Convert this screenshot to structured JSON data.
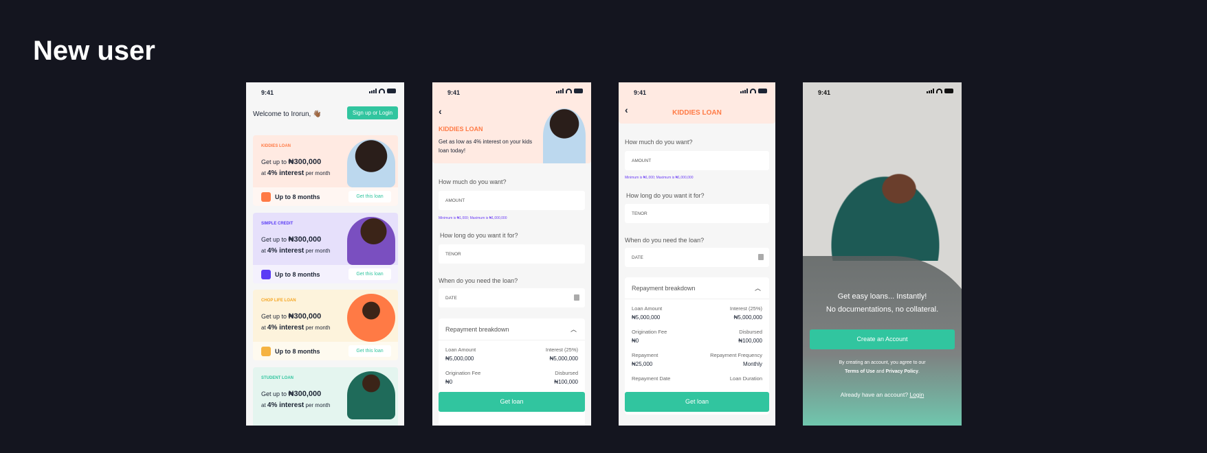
{
  "page_title": "New user",
  "status_time": "9:41",
  "colors": {
    "accent": "#31c59f",
    "kiddies": "#ff7a45",
    "simple": "#5b3df5",
    "chop": "#f5a623",
    "student": "#31c59f",
    "background": "#14151f"
  },
  "home": {
    "welcome": "Welcome to Irorun, 👋🏾",
    "signup_button": "Sign up or Login",
    "cards": [
      {
        "tag": "KIDDIES LOAN",
        "line1_prefix": "Get up to ",
        "amount": "₦300,000",
        "line2_prefix": "at ",
        "rate": "4% interest",
        "line2_suffix": " per month",
        "duration": "Up to 8 months",
        "button": "Get this loan"
      },
      {
        "tag": "SIMPLE CREDIT",
        "line1_prefix": "Get up to ",
        "amount": "₦300,000",
        "line2_prefix": "at ",
        "rate": "4% interest",
        "line2_suffix": " per month",
        "duration": "Up to 8 months",
        "button": "Get this loan"
      },
      {
        "tag": "CHOP LIFE LOAN",
        "line1_prefix": "Get up to ",
        "amount": "₦300,000",
        "line2_prefix": "at ",
        "rate": "4% interest",
        "line2_suffix": " per month",
        "duration": "Up to 8 months",
        "button": "Get this loan"
      },
      {
        "tag": "STUDENT LOAN",
        "line1_prefix": "Get up to ",
        "amount": "₦300,000",
        "line2_prefix": "at ",
        "rate": "4% interest",
        "line2_suffix": " per month"
      }
    ]
  },
  "loan_form": {
    "title": "KIDDIES LOAN",
    "subtitle": "Get as low as 4% interest on your kids loan today!",
    "q_amount": "How much do you want?",
    "amount_placeholder": "AMOUNT",
    "amount_help": "Minimum is ₦1,000; Maximum is ₦1,000,000",
    "q_tenor": "How long do you want it for?",
    "tenor_placeholder": "TENOR",
    "q_date": "When do you need the loan?",
    "date_placeholder": "DATE",
    "breakdown_title": "Repayment breakdown",
    "rows": [
      {
        "l": "Loan Amount",
        "lv": "₦5,000,000",
        "r": "Interest (25%)",
        "rv": "₦5,000,000"
      },
      {
        "l": "Origination Fee",
        "lv": "₦0",
        "r": "Disbursed",
        "rv": "₦100,000"
      },
      {
        "l": "Repayment",
        "lv": "₦25,000",
        "r": "Repayment Frequency",
        "rv": "Monthly"
      },
      {
        "l": "Repayment Date",
        "r": "Loan Duration"
      }
    ],
    "get_loan": "Get loan"
  },
  "onboard": {
    "headline1": "Get easy loans... Instantly!",
    "headline2": "No documentations, no collateral.",
    "create_button": "Create an Account",
    "terms_prefix": "By creating an account, you agree to our",
    "terms_link": "Terms of Use",
    "terms_and": " and ",
    "privacy_link": "Privacy Policy",
    "terms_end": ".",
    "login_prefix": "Already have an account? ",
    "login_link": "Login"
  }
}
